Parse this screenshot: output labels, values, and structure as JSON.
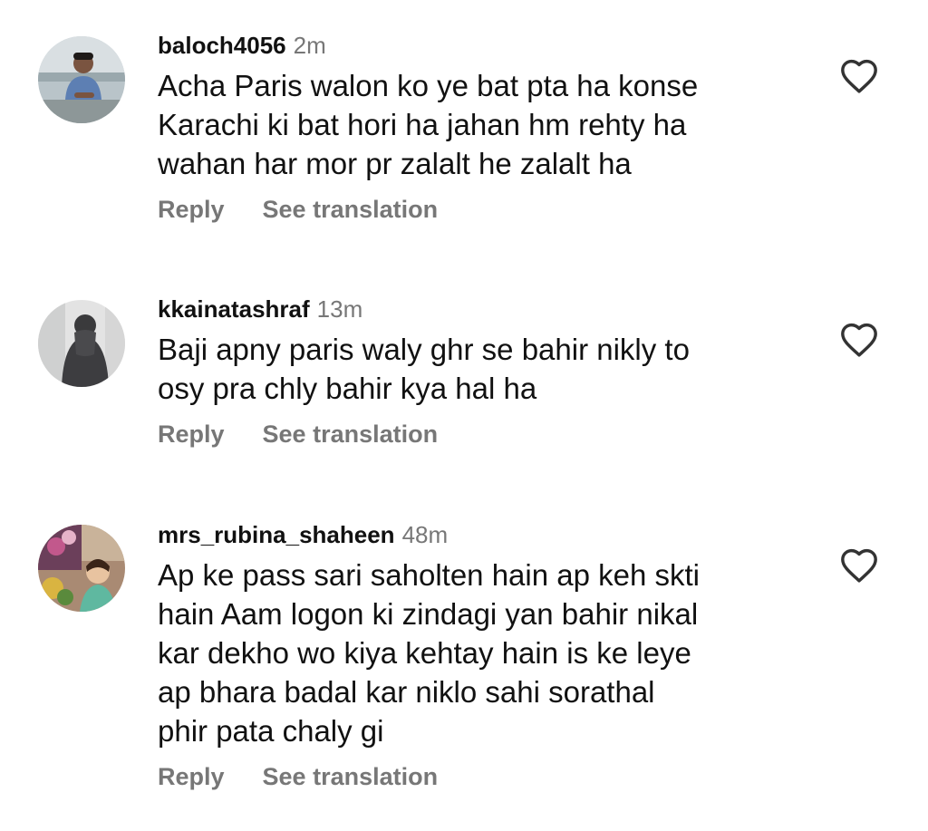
{
  "comments": [
    {
      "username": "baloch4056",
      "time": "2m",
      "lines": [
        "Acha Paris walon ko ye bat pta ha konse",
        "Karachi ki bat hori ha jahan hm rehty ha",
        "wahan har mor pr zalalt he zalalt ha"
      ],
      "reply_label": "Reply",
      "translate_label": "See translation",
      "like_icon": "heart-outline-icon"
    },
    {
      "username": "kkainatashraf",
      "time": "13m",
      "lines": [
        "Baji apny paris waly ghr se bahir nikly to",
        "osy pra chly bahir kya hal ha"
      ],
      "reply_label": "Reply",
      "translate_label": "See translation",
      "like_icon": "heart-outline-icon"
    },
    {
      "username": "mrs_rubina_shaheen",
      "time": "48m",
      "lines": [
        "Ap ke pass sari saholten hain ap keh skti",
        "hain Aam logon ki zindagi yan bahir nikal",
        "kar dekho wo kiya kehtay hain is ke leye",
        "ap bhara badal kar niklo sahi sorathal",
        "phir pata chaly gi"
      ],
      "reply_label": "Reply",
      "translate_label": "See translation",
      "like_icon": "heart-outline-icon"
    }
  ],
  "colors": {
    "text": "#111111",
    "secondary": "#777777",
    "background": "#ffffff"
  }
}
